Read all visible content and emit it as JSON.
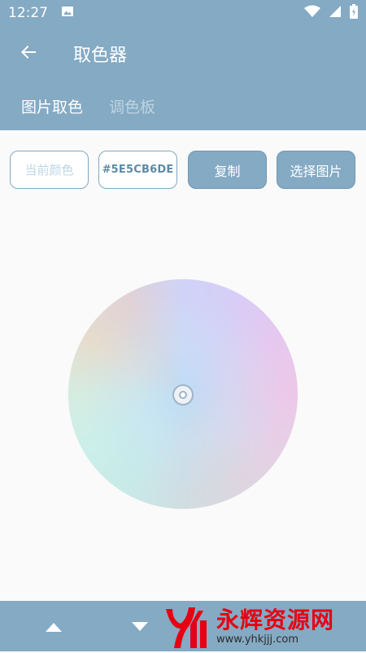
{
  "status_bar": {
    "time": "12:27"
  },
  "app_bar": {
    "title": "取色器"
  },
  "tabs": [
    {
      "label": "图片取色",
      "active": true
    },
    {
      "label": "调色板",
      "active": false
    }
  ],
  "controls": {
    "current_color_label": "当前颜色",
    "hex_value": "#5E5CB6DE",
    "copy_label": "复制",
    "pick_image_label": "选择图片"
  },
  "watermark": {
    "brand_cn": "永辉资源网",
    "url": "www.yhkjjj.com"
  },
  "colors": {
    "primary": "#84aac4",
    "background": "#fafafa",
    "watermark_red": "#e60012"
  },
  "icons": [
    "image-icon",
    "wifi-icon",
    "signal-icon",
    "battery-icon",
    "back-arrow-icon",
    "nav-up-icon",
    "nav-down-icon"
  ]
}
